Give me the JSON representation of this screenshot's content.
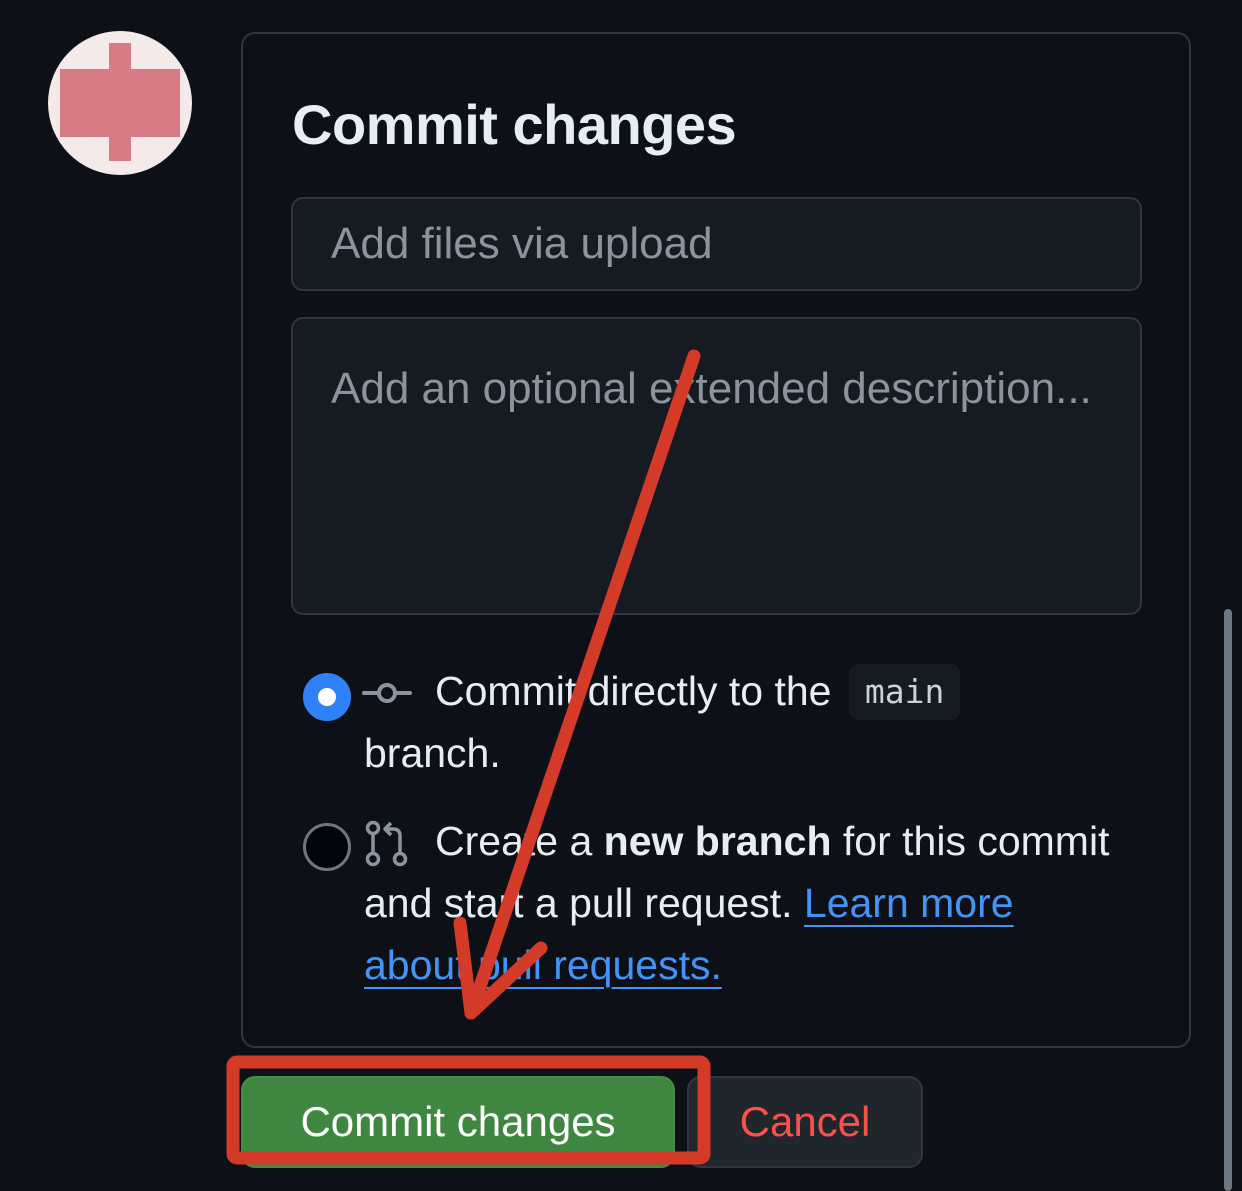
{
  "dialog": {
    "title": "Commit changes",
    "summary_placeholder": "Add files via upload",
    "description_placeholder": "Add an optional extended description..."
  },
  "options": {
    "direct": {
      "selected": true,
      "text_before": "Commit directly to the",
      "branch": "main",
      "text_after": "branch.",
      "icon": "git-commit-icon"
    },
    "new_branch": {
      "selected": false,
      "text_before": "Create a",
      "bold": "new branch",
      "text_after": "for this commit and start a pull request.",
      "link": "Learn more about pull requests.",
      "icon": "git-pull-request-icon"
    }
  },
  "buttons": {
    "commit": "Commit changes",
    "cancel": "Cancel"
  },
  "colors": {
    "background": "#0d1117",
    "accent_blue": "#2f81f7",
    "link_blue": "#4493f8",
    "commit_green": "#3f8741",
    "cancel_red": "#f85149",
    "annotation_red": "#d33a28"
  }
}
